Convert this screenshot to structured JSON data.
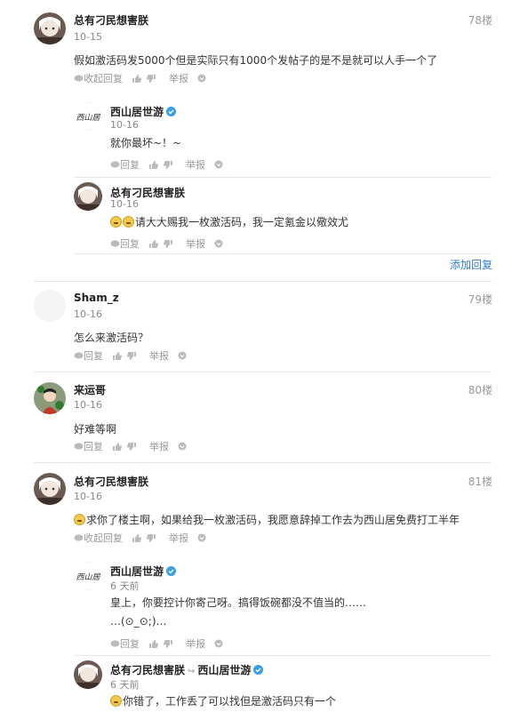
{
  "posts": [
    {
      "author": "总有刁民想害朕",
      "date": "10-15",
      "floor": "78楼",
      "content": "假如激活码发5000个但是实际只有1000个发帖子的是不是就可以人手一个了",
      "actions": {
        "toggle": "收起回复",
        "report": "举报"
      },
      "replies": [
        {
          "author": "西山居世游",
          "date": "10-16",
          "content": "就你最坏~！~",
          "reply_label": "回复",
          "report": "举报"
        },
        {
          "author": "总有刁民想害朕",
          "date": "10-16",
          "content": "请大大赐我一枚激活码，我一定氪金以儆效尤",
          "reply_label": "回复",
          "report": "举报"
        }
      ],
      "add_reply": "添加回复"
    },
    {
      "author": "Sham_z",
      "date": "10-16",
      "floor": "79楼",
      "content": "怎么来激活码？",
      "actions": {
        "reply": "回复",
        "report": "举报"
      }
    },
    {
      "author": "来运哥",
      "date": "10-16",
      "floor": "80楼",
      "content": "好难等啊",
      "actions": {
        "reply": "回复",
        "report": "举报"
      }
    },
    {
      "author": "总有刁民想害朕",
      "date": "10-16",
      "floor": "81楼",
      "content": "求你了楼主啊，如果给我一枚激活码，我愿意辞掉工作去为西山居免费打工半年",
      "actions": {
        "toggle": "收起回复",
        "report": "举报"
      },
      "replies": [
        {
          "author": "西山居世游",
          "date": "6 天前",
          "content": "皇上，你要控计你寄己呀。搞得饭碗都没不值当的……",
          "content2": "…(⊙_⊙;)…",
          "reply_label": "回复",
          "report": "举报"
        },
        {
          "author": "总有刁民想害朕",
          "reply_to": "西山居世游",
          "date": "6 天前",
          "content": "你错了，工作丢了可以找但是激活码只有一个"
        }
      ]
    }
  ],
  "colors": {
    "link": "#2d7dd2",
    "verified": "#3a9ee8",
    "muted": "#999999"
  }
}
